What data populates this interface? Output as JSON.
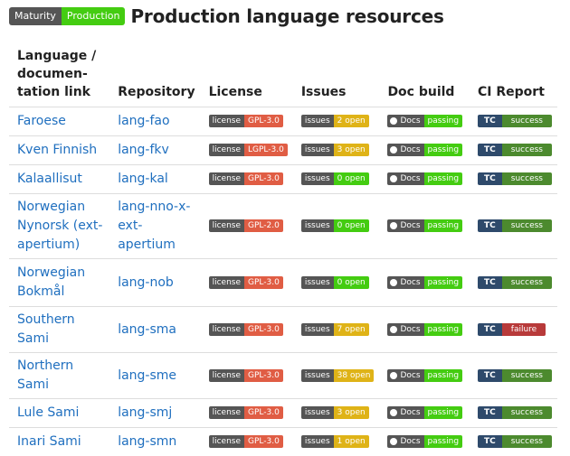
{
  "header": {
    "maturity_label": "Maturity",
    "maturity_value": "Production",
    "title": "Production language resources"
  },
  "columns": [
    "Language / documen-tation link",
    "Repository",
    "License",
    "Issues",
    "Doc build",
    "CI Report"
  ],
  "badges": {
    "license_label": "license",
    "issues_label": "issues",
    "docs_label": "Docs",
    "docs_status": "passing",
    "tc_label": "TC"
  },
  "rows": [
    {
      "language": "Faroese",
      "repo": "lang-fao",
      "license": "GPL-3.0",
      "issues": "2 open",
      "issues_color": "yellow",
      "ci": "success"
    },
    {
      "language": "Kven Finnish",
      "repo": "lang-fkv",
      "license": "LGPL-3.0",
      "issues": "3 open",
      "issues_color": "yellow",
      "ci": "success"
    },
    {
      "language": "Kalaallisut",
      "repo": "lang-kal",
      "license": "GPL-3.0",
      "issues": "0 open",
      "issues_color": "green",
      "ci": "success"
    },
    {
      "language": "Norwegian Nynorsk (ext-apertium)",
      "repo": "lang-nno-x-ext-apertium",
      "license": "GPL-2.0",
      "issues": "0 open",
      "issues_color": "green",
      "ci": "success"
    },
    {
      "language": "Norwegian Bokmål",
      "repo": "lang-nob",
      "license": "GPL-3.0",
      "issues": "0 open",
      "issues_color": "green",
      "ci": "success"
    },
    {
      "language": "Southern Sami",
      "repo": "lang-sma",
      "license": "GPL-3.0",
      "issues": "7 open",
      "issues_color": "yellow",
      "ci": "failure"
    },
    {
      "language": "Northern Sami",
      "repo": "lang-sme",
      "license": "GPL-3.0",
      "issues": "38 open",
      "issues_color": "yellow",
      "ci": "success"
    },
    {
      "language": "Lule Sami",
      "repo": "lang-smj",
      "license": "GPL-3.0",
      "issues": "3 open",
      "issues_color": "yellow",
      "ci": "success"
    },
    {
      "language": "Inari Sami",
      "repo": "lang-smn",
      "license": "GPL-3.0",
      "issues": "1 open",
      "issues_color": "yellow",
      "ci": "success"
    }
  ]
}
